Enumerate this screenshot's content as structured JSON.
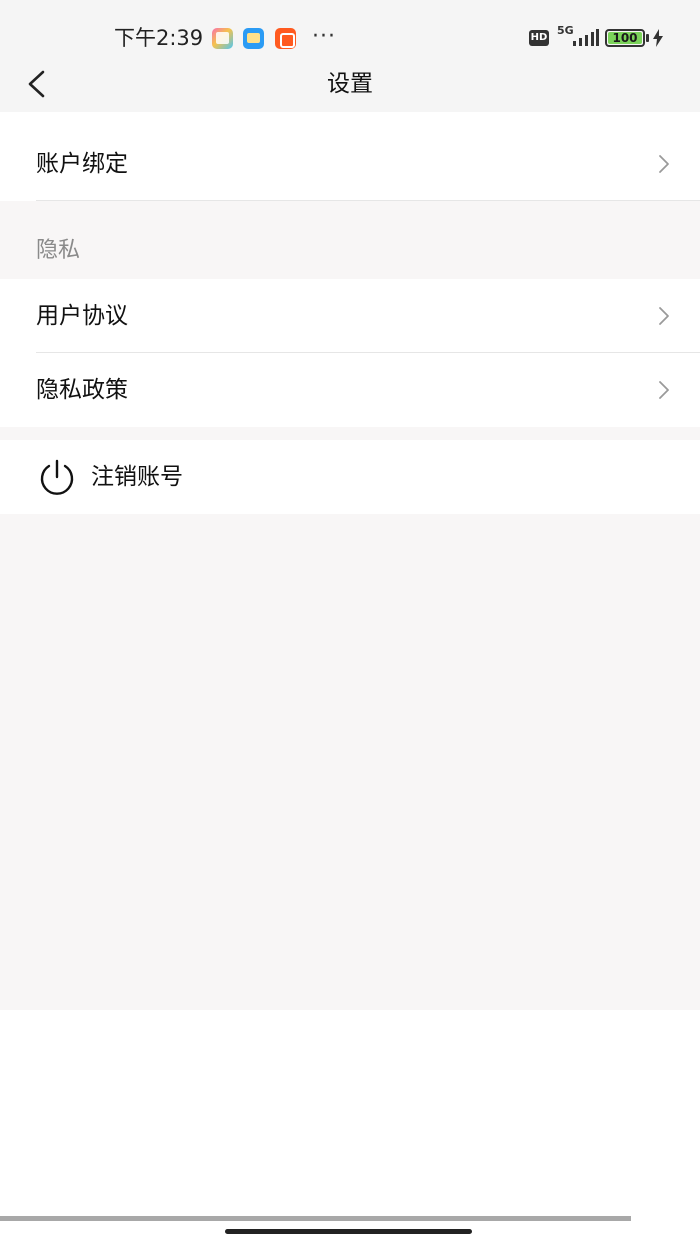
{
  "status_bar": {
    "time": "下午2:39",
    "more": "···",
    "hd": "HD",
    "network": "5G",
    "battery": "100"
  },
  "nav": {
    "title": "设置"
  },
  "settings": {
    "account_binding": "账户绑定",
    "privacy_section": "隐私",
    "user_agreement": "用户协议",
    "privacy_policy": "隐私政策",
    "deactivate_account": "注销账号"
  },
  "colors": {
    "header_bg": "#f5f5f5",
    "content_bg": "#f8f6f6",
    "battery_green": "#7bd35a",
    "section_header_text": "#8a8a8a"
  }
}
